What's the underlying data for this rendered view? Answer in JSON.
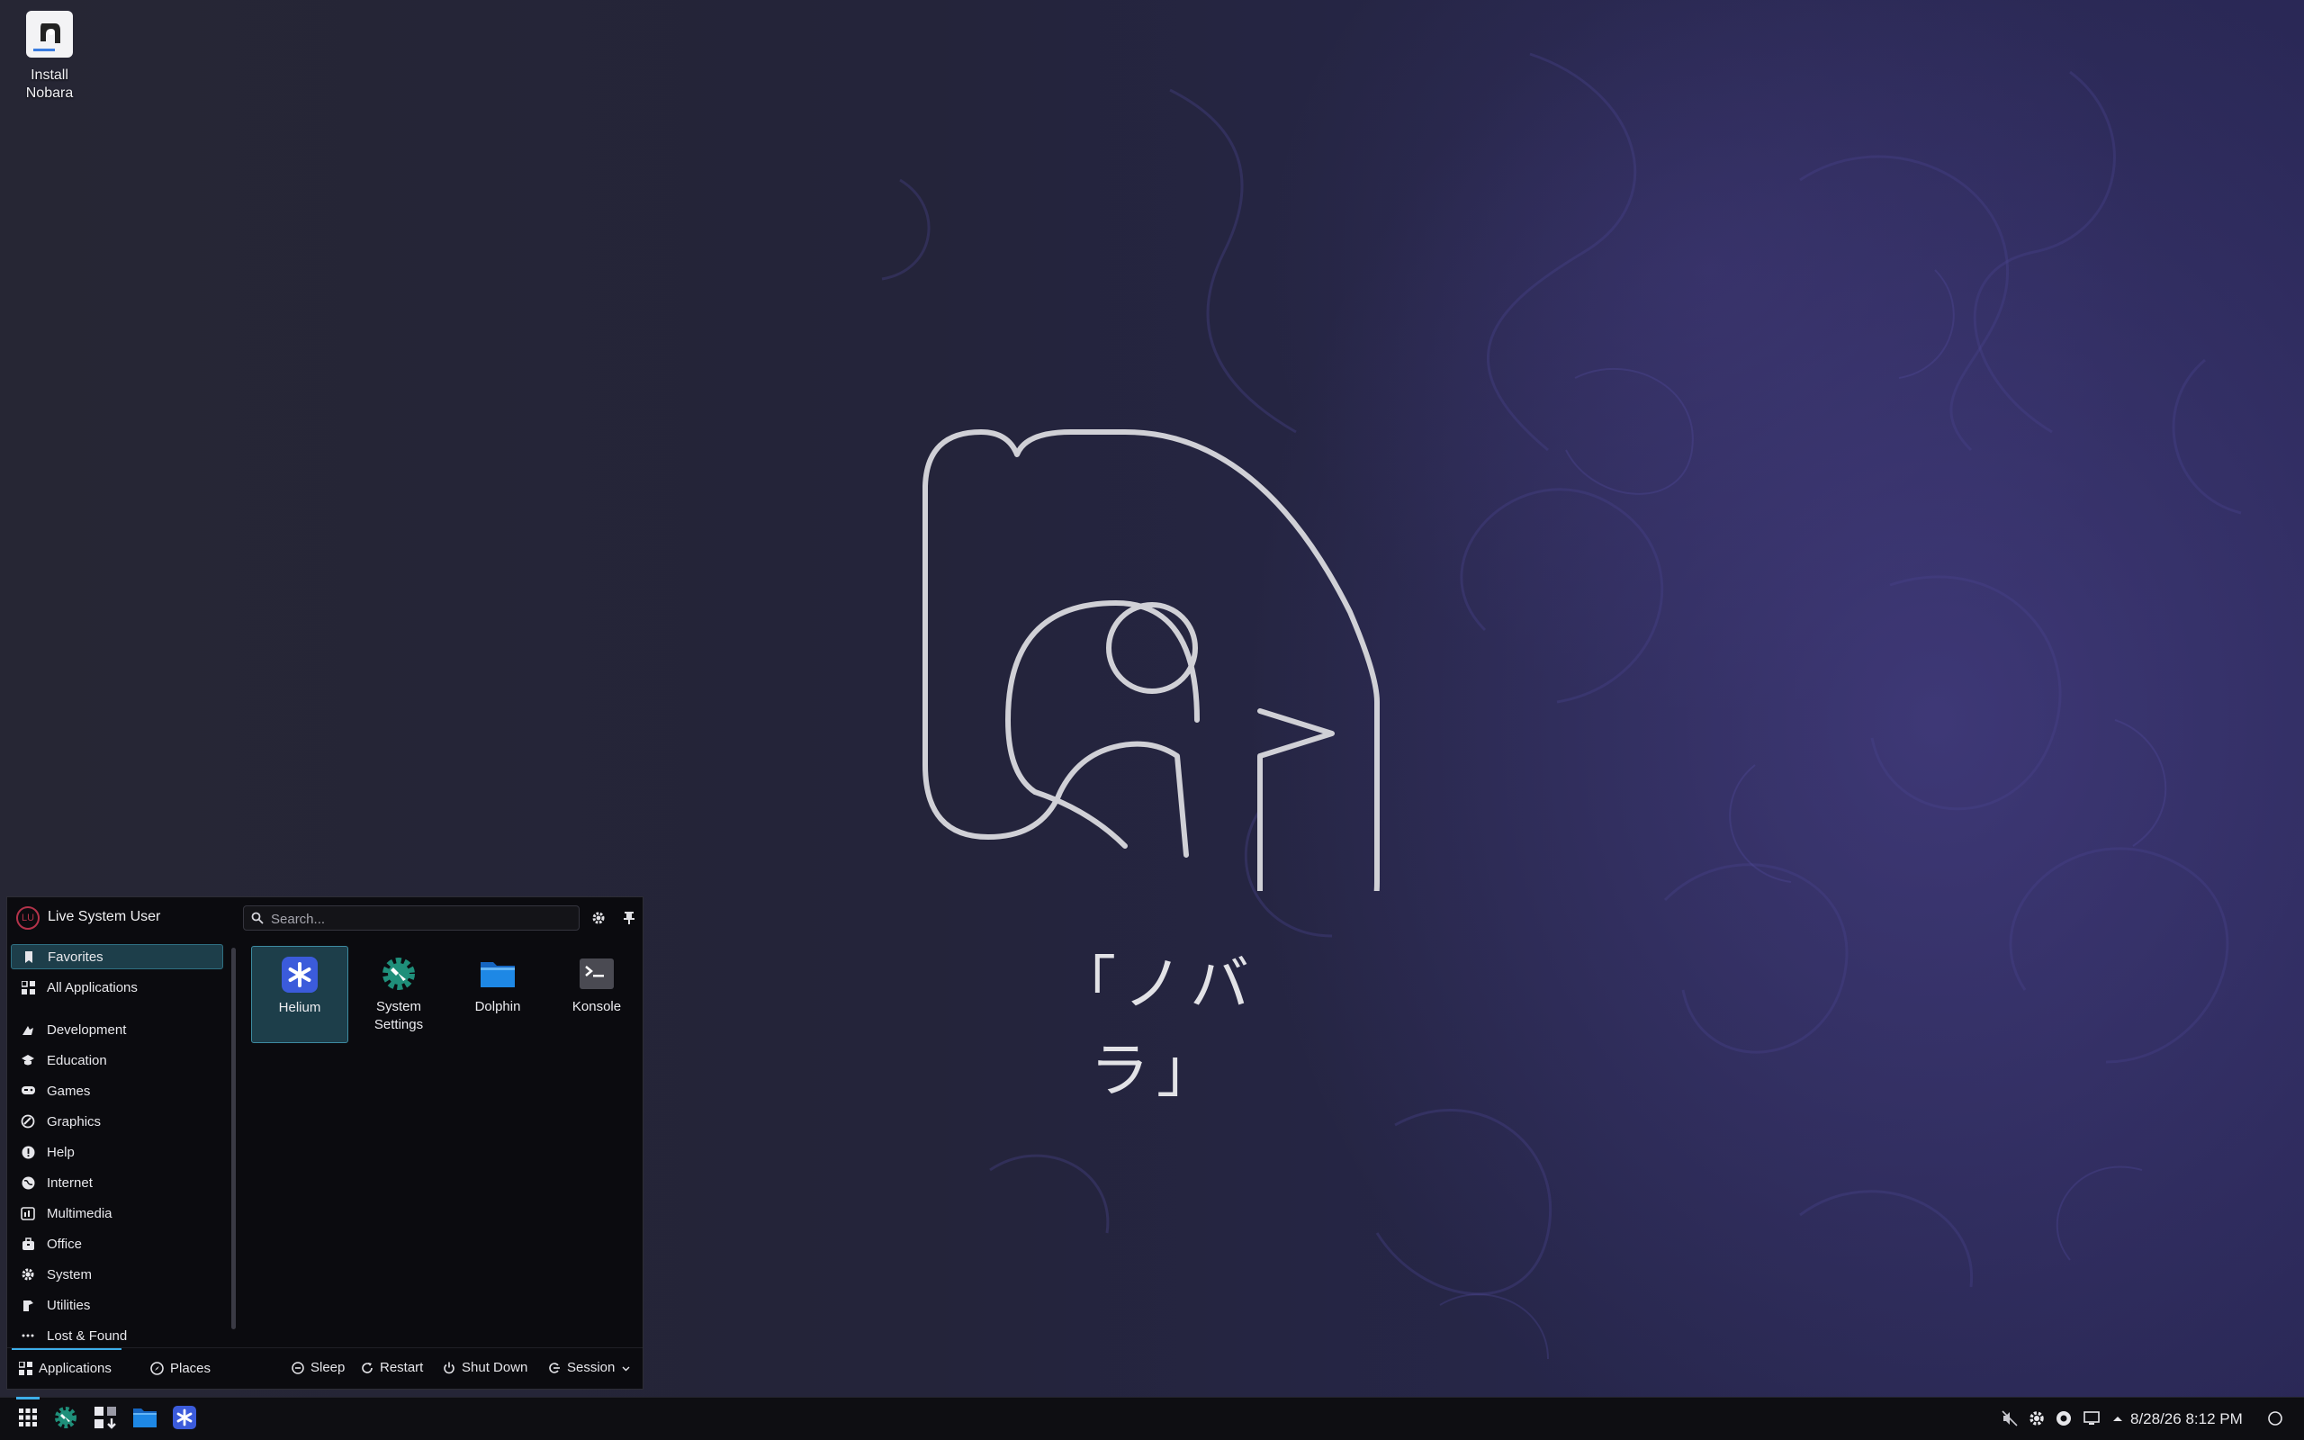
{
  "desktop": {
    "icons": [
      {
        "label_line1": "Install",
        "label_line2": "Nobara",
        "icon": "nobara-installer-icon"
      }
    ],
    "wallpaper_text": "「ノバラ」"
  },
  "launcher": {
    "user": {
      "initials": "LU",
      "name": "Live System User"
    },
    "search": {
      "placeholder": "Search..."
    },
    "categories": [
      {
        "label": "Favorites",
        "icon": "bookmark-icon",
        "active": true
      },
      {
        "label": "All Applications",
        "icon": "grid-icon"
      },
      {
        "label": "Development",
        "icon": "development-icon"
      },
      {
        "label": "Education",
        "icon": "education-icon"
      },
      {
        "label": "Games",
        "icon": "gamepad-icon"
      },
      {
        "label": "Graphics",
        "icon": "graphics-icon"
      },
      {
        "label": "Help",
        "icon": "help-icon"
      },
      {
        "label": "Internet",
        "icon": "globe-icon"
      },
      {
        "label": "Multimedia",
        "icon": "multimedia-icon"
      },
      {
        "label": "Office",
        "icon": "office-icon"
      },
      {
        "label": "System",
        "icon": "system-gear-icon"
      },
      {
        "label": "Utilities",
        "icon": "utilities-icon"
      },
      {
        "label": "Lost & Found",
        "icon": "ellipsis-icon"
      }
    ],
    "apps": [
      {
        "label": "Helium",
        "icon": "helium-icon",
        "selected": true
      },
      {
        "label": "System Settings",
        "label_line1": "System",
        "label_line2": "Settings",
        "icon": "system-settings-icon"
      },
      {
        "label": "Dolphin",
        "icon": "folder-icon"
      },
      {
        "label": "Konsole",
        "icon": "terminal-icon"
      }
    ],
    "footer": {
      "applications": "Applications",
      "places": "Places",
      "sleep": "Sleep",
      "restart": "Restart",
      "shutdown": "Shut Down",
      "session": "Session"
    }
  },
  "taskbar": {
    "items": [
      "app-launcher-icon",
      "system-settings-icon",
      "discover-icon",
      "dolphin-icon",
      "helium-icon"
    ],
    "tray": [
      "speaker-muted-icon",
      "settings-icon",
      "record-icon",
      "expand-arrow-icon",
      "display-icon"
    ],
    "clock": "8/28/26  8:12 PM"
  },
  "colors": {
    "accent": "#3daee9",
    "selection": "#1d3e4a",
    "panel": "#0b0b0f",
    "helium": "#3b5bdb",
    "settings": "#1f8f7a",
    "folder": "#1e88e5"
  }
}
